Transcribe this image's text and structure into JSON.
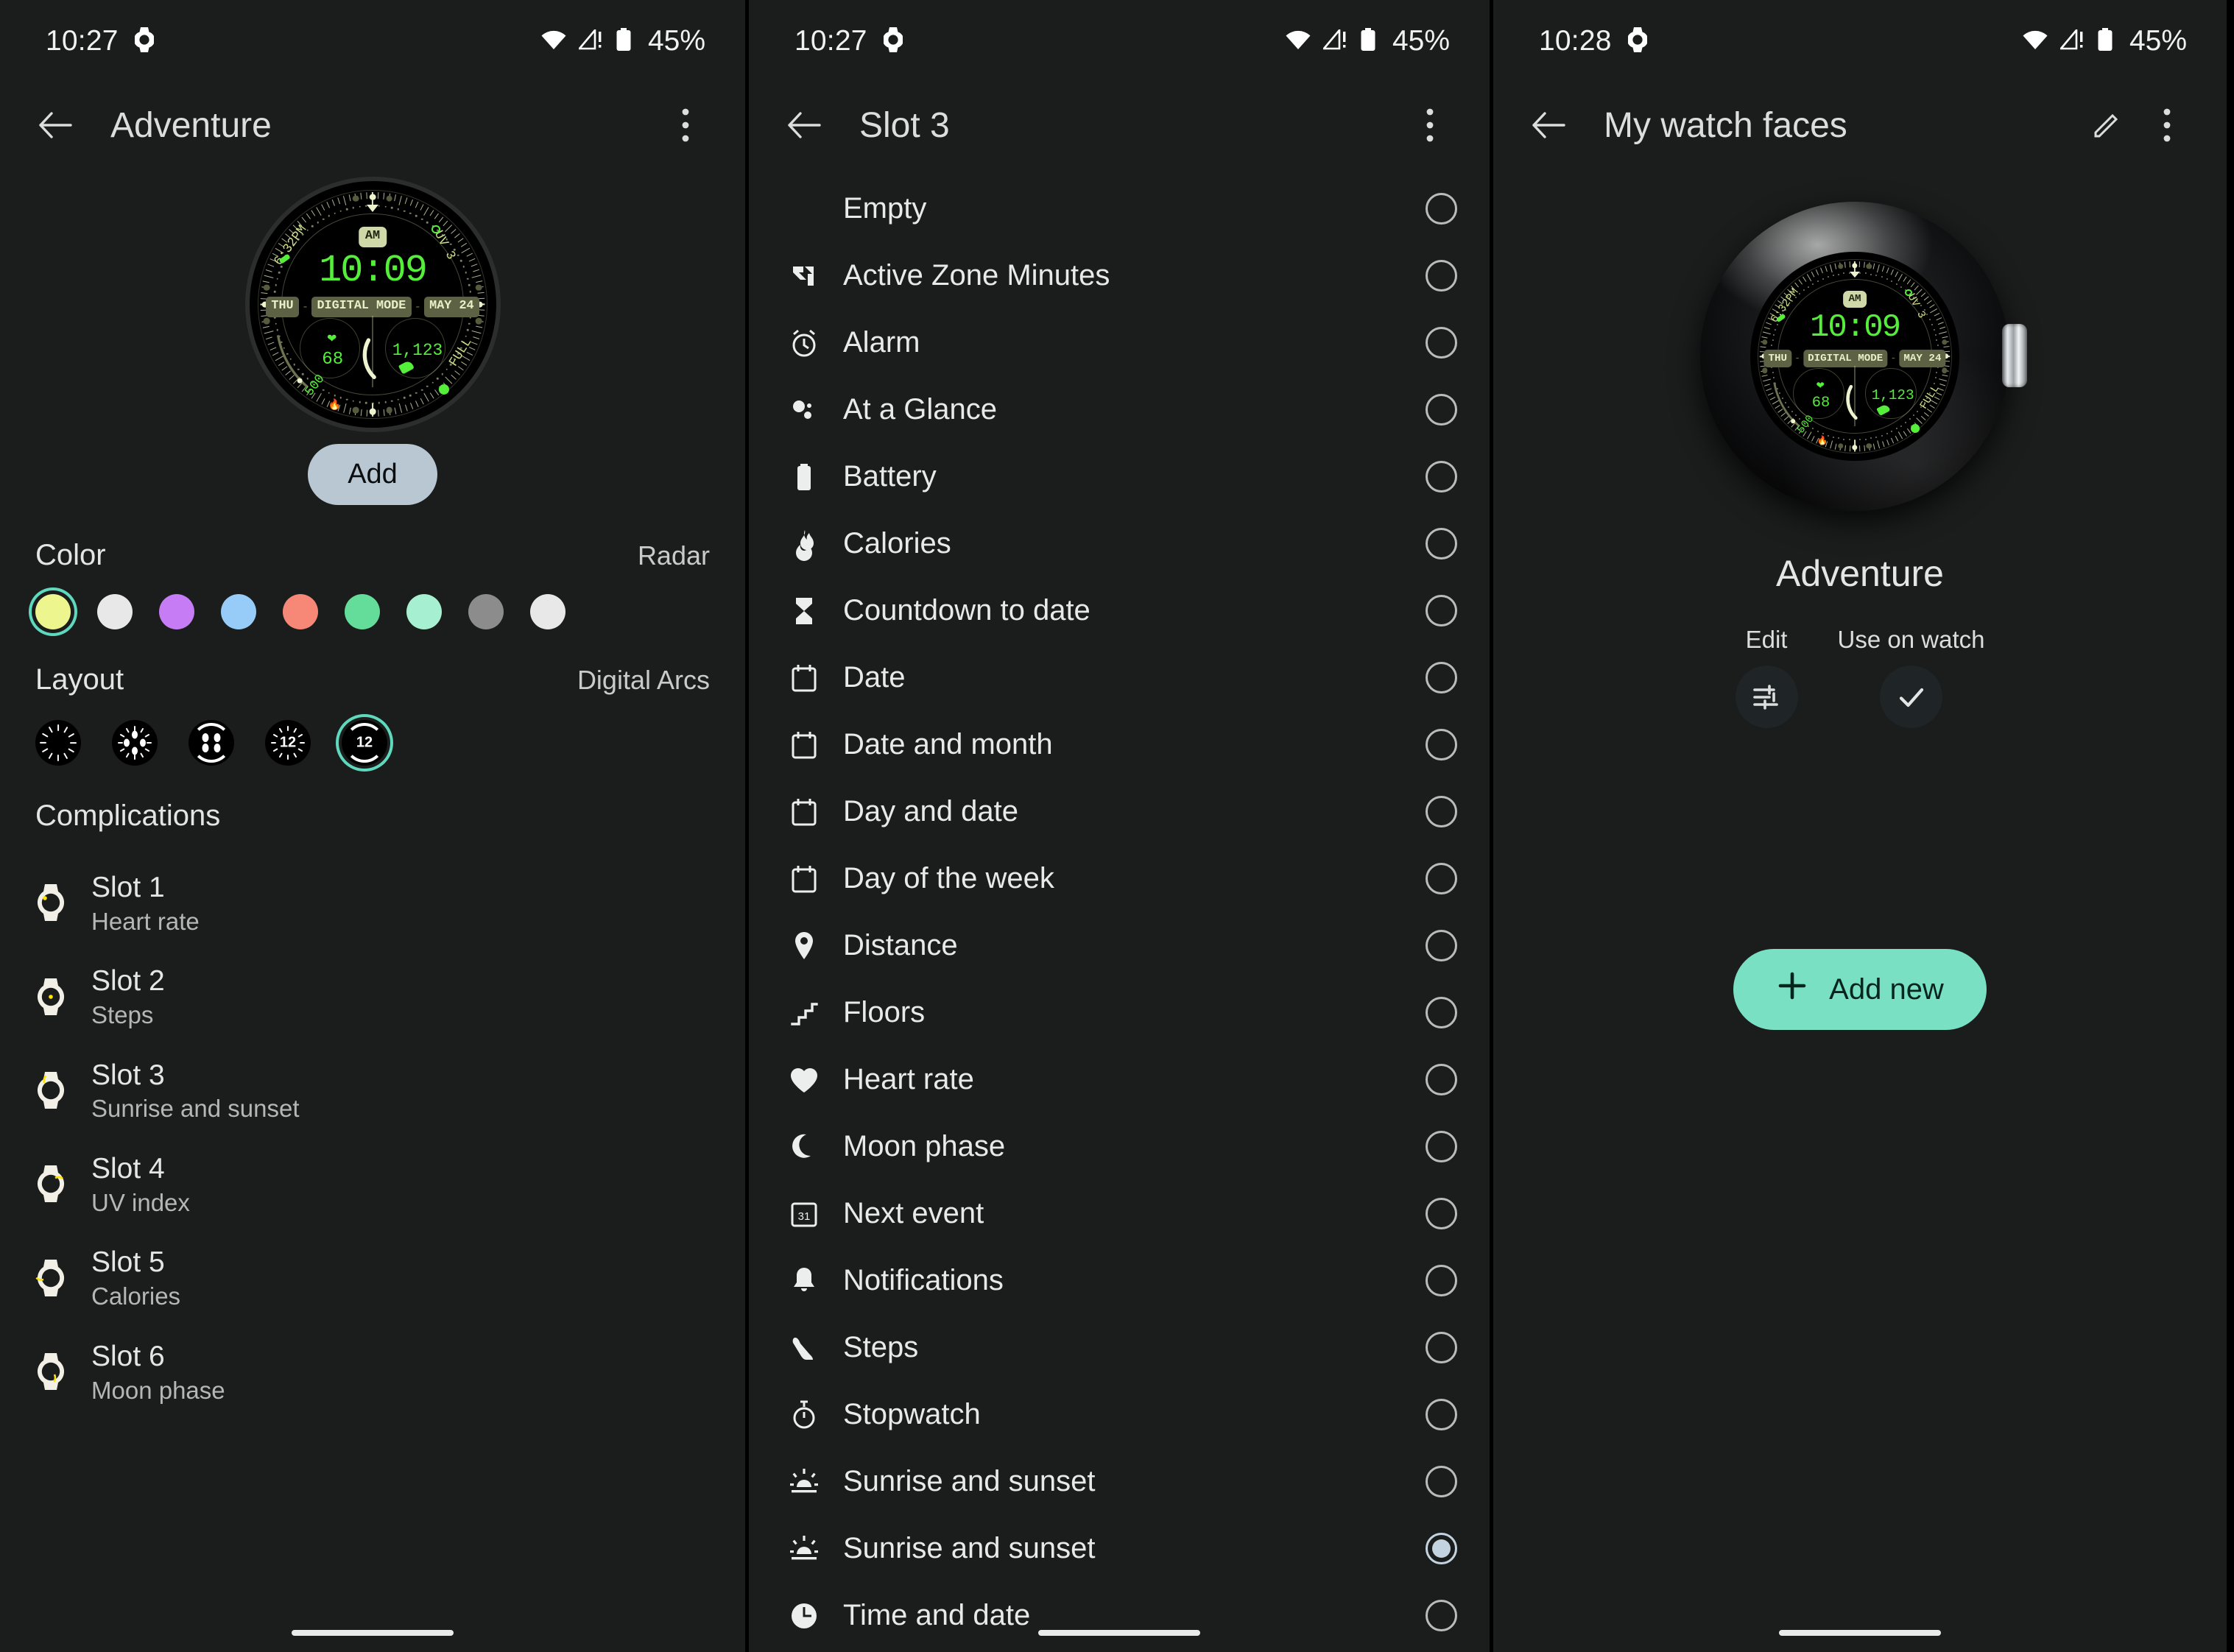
{
  "status_bar": {
    "left_time_1": "10:27",
    "left_time_2": "10:27",
    "left_time_3": "10:28",
    "watch_icon": "watch-icon",
    "wifi_icon": "wifi-icon",
    "cell_icon": "cell-signal-warning-icon",
    "battery_icon": "battery-icon",
    "battery_pct": "45%"
  },
  "watch_face": {
    "am_pm": "AM",
    "time": "10:09",
    "day": "THU",
    "mode": "DIGITAL MODE",
    "date": "MAY 24",
    "heart_rate": "68",
    "steps": "1,123",
    "sunset": "6:32PM",
    "uv": "UV 3",
    "calories": "500",
    "moon": "FULL"
  },
  "panel_left": {
    "back_icon": "back-arrow-icon",
    "title": "Adventure",
    "overflow_icon": "more-vertical-icon",
    "add_label": "Add",
    "color": {
      "title": "Color",
      "value": "Radar",
      "selected_index": 0,
      "swatches": [
        "#edf58f",
        "#e8e8e8",
        "#c57cf5",
        "#96ccf7",
        "#f78878",
        "#64dd9b",
        "#a6f0d1",
        "#8c8c8c",
        "#e8e8e8"
      ],
      "selection_ring": "#5fd9bd"
    },
    "layout": {
      "title": "Layout",
      "value": "Digital Arcs",
      "selected_index": 4,
      "options": [
        "ticks-only",
        "ticks-dots",
        "thick-arcs",
        "ticks-numeral-12",
        "arcs-numeral-12"
      ]
    },
    "complications": {
      "title": "Complications",
      "slots": [
        {
          "name": "Slot 1",
          "value": "Heart rate",
          "icon": "watch-slot-icon"
        },
        {
          "name": "Slot 2",
          "value": "Steps",
          "icon": "watch-slot-icon"
        },
        {
          "name": "Slot 3",
          "value": "Sunrise and sunset",
          "icon": "watch-slot-icon"
        },
        {
          "name": "Slot 4",
          "value": "UV index",
          "icon": "watch-slot-icon"
        },
        {
          "name": "Slot 5",
          "value": "Calories",
          "icon": "watch-slot-icon"
        },
        {
          "name": "Slot 6",
          "value": "Moon phase",
          "icon": "watch-slot-icon"
        }
      ]
    }
  },
  "panel_mid": {
    "back_icon": "back-arrow-icon",
    "title": "Slot 3",
    "overflow_icon": "more-vertical-icon",
    "items": [
      {
        "label": "Empty",
        "icon": "none",
        "selected": false
      },
      {
        "label": "Active Zone Minutes",
        "icon": "zone-arrow-icon",
        "selected": false
      },
      {
        "label": "Alarm",
        "icon": "alarm-icon",
        "selected": false
      },
      {
        "label": "At a Glance",
        "icon": "glance-dots-icon",
        "selected": false
      },
      {
        "label": "Battery",
        "icon": "battery-icon",
        "selected": false
      },
      {
        "label": "Calories",
        "icon": "flame-icon",
        "selected": false
      },
      {
        "label": "Countdown to date",
        "icon": "hourglass-icon",
        "selected": false
      },
      {
        "label": "Date",
        "icon": "calendar-icon",
        "selected": false
      },
      {
        "label": "Date and month",
        "icon": "calendar-icon",
        "selected": false
      },
      {
        "label": "Day and date",
        "icon": "calendar-icon",
        "selected": false
      },
      {
        "label": "Day of the week",
        "icon": "calendar-icon",
        "selected": false
      },
      {
        "label": "Distance",
        "icon": "location-pin-icon",
        "selected": false
      },
      {
        "label": "Floors",
        "icon": "stairs-icon",
        "selected": false
      },
      {
        "label": "Heart rate",
        "icon": "heart-icon",
        "selected": false
      },
      {
        "label": "Moon phase",
        "icon": "moon-icon",
        "selected": false
      },
      {
        "label": "Next event",
        "icon": "calendar-31-icon",
        "selected": false
      },
      {
        "label": "Notifications",
        "icon": "bell-icon",
        "selected": false
      },
      {
        "label": "Steps",
        "icon": "shoe-icon",
        "selected": false
      },
      {
        "label": "Stopwatch",
        "icon": "stopwatch-icon",
        "selected": false
      },
      {
        "label": "Sunrise and sunset",
        "icon": "sunrise-icon",
        "selected": false
      },
      {
        "label": "Sunrise and sunset",
        "icon": "sunrise-icon",
        "selected": true
      },
      {
        "label": "Time and date",
        "icon": "clock-icon",
        "selected": false
      }
    ]
  },
  "panel_right": {
    "back_icon": "back-arrow-icon",
    "title": "My watch faces",
    "edit_pencil_icon": "pencil-icon",
    "overflow_icon": "more-vertical-icon",
    "face_name": "Adventure",
    "actions": [
      {
        "label": "Edit",
        "icon": "tune-sliders-icon"
      },
      {
        "label": "Use on watch",
        "icon": "check-icon"
      }
    ],
    "add_new_label": "Add new",
    "add_new_icon": "plus-icon",
    "add_new_color": "#79e0c3"
  }
}
